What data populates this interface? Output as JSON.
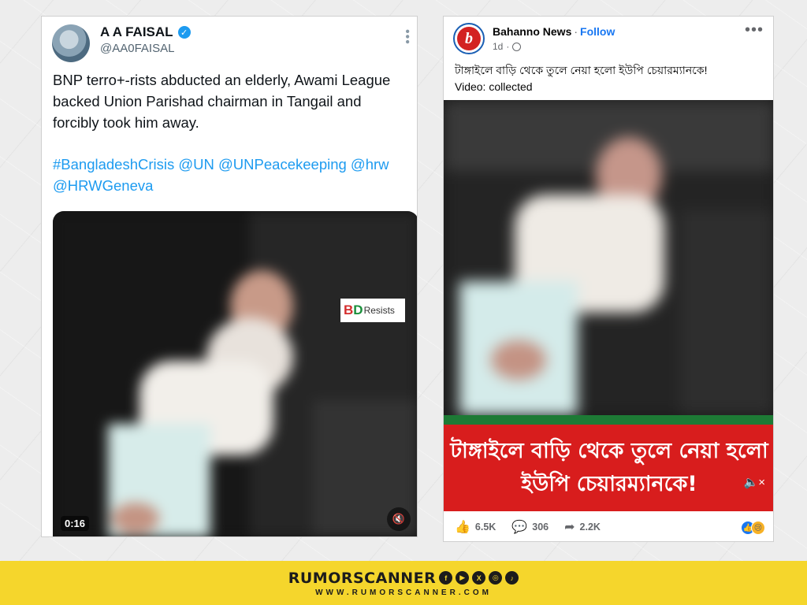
{
  "tweet": {
    "name": "A A FAISAL",
    "handle": "@AA0FAISAL",
    "text": "BNP terro+-rists abducted an elderly, Awami League backed Union Parishad chairman in Tangail and forcibly took him away.",
    "hashtags": "#BangladeshCrisis @UN @UNPeacekeeping @hrw @HRWGeneva",
    "video_time": "0:16",
    "watermark": {
      "b": "B",
      "d": "D",
      "rest": "Resists"
    }
  },
  "fb": {
    "page_name": "Bahanno News",
    "follow": "Follow",
    "time": "1d",
    "caption": "টাঙ্গাইলে বাড়ি থেকে তুলে নেয়া হলো ইউপি চেয়ারম্যানকে!",
    "caption2": "Video: collected",
    "banner_line1": "টাঙ্গাইলে বাড়ি থেকে তুলে নেয়া হলো",
    "banner_line2": "ইউপি চেয়ারম্যানকে!",
    "likes": "6.5K",
    "comments": "306",
    "shares": "2.2K",
    "avatar_letter": "b"
  },
  "footer": {
    "brand": "RUMORSCANNER",
    "site": "WWW.RUMORSCANNER.COM"
  },
  "colors": {
    "fb_red": "#d81d1d",
    "twitter_blue": "#1d9bf0",
    "footer_yellow": "#f5d62c"
  }
}
